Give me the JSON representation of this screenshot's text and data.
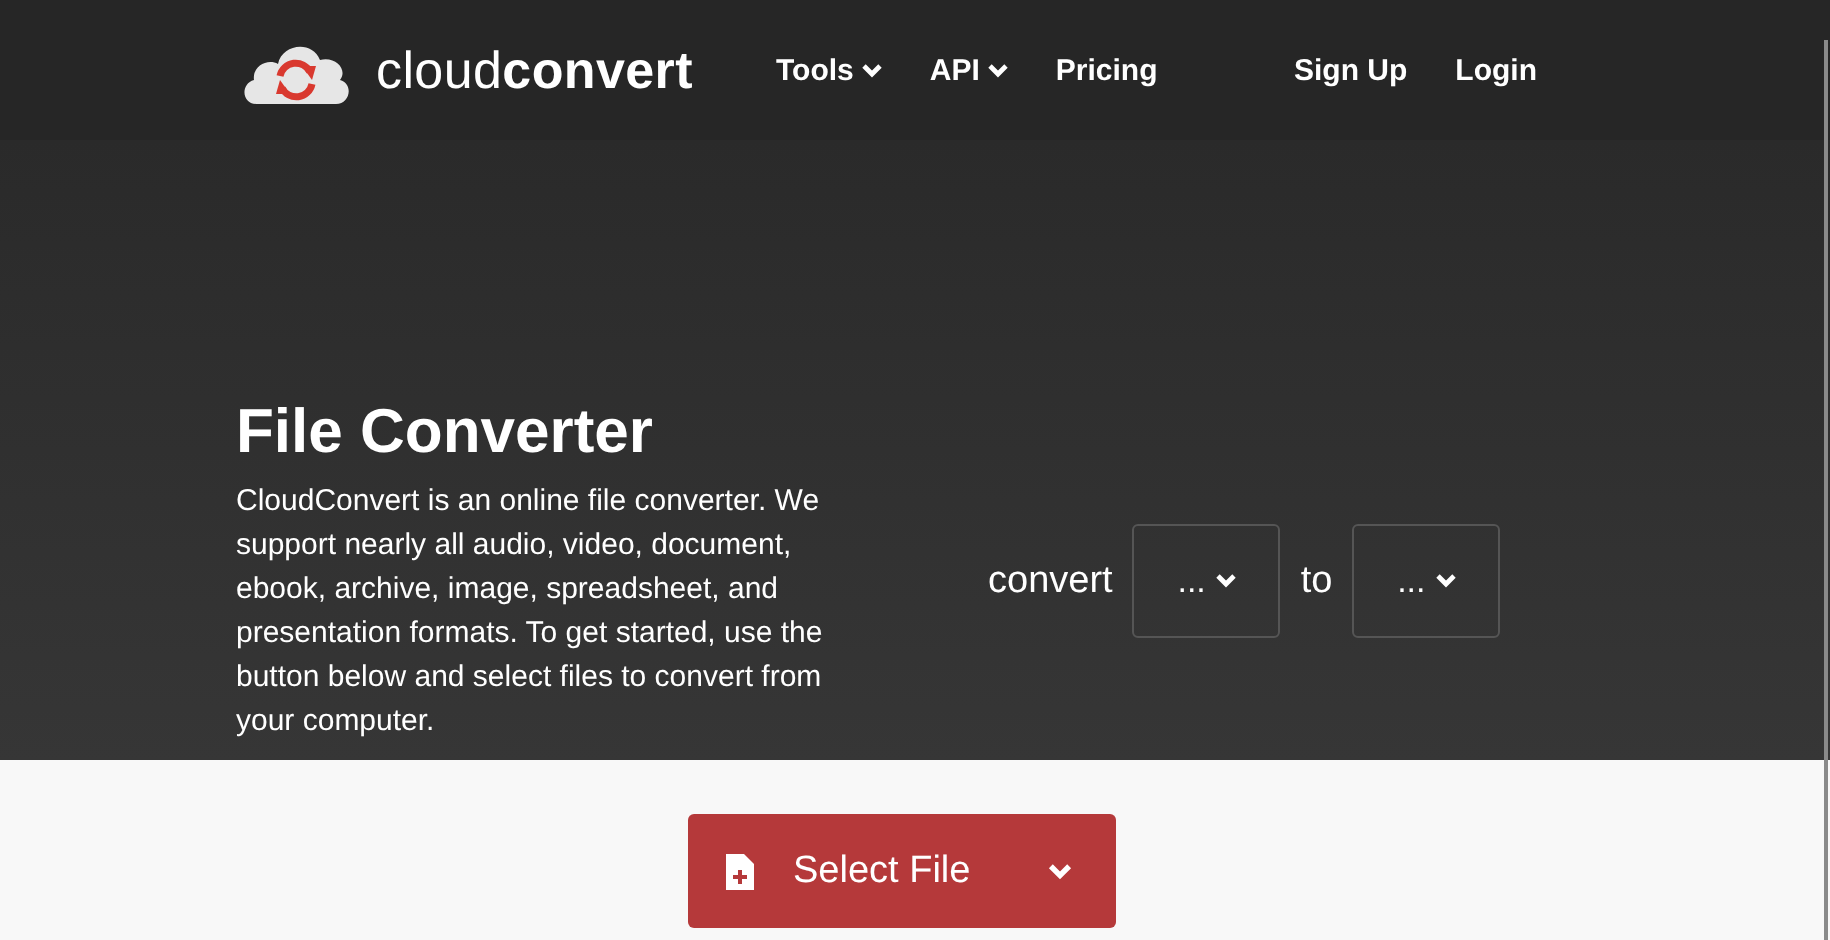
{
  "header": {
    "brand": "cloud**convert**",
    "nav": [
      {
        "label": "Tools",
        "dropdown": true
      },
      {
        "label": "API",
        "dropdown": true
      },
      {
        "label": "Pricing",
        "dropdown": false
      }
    ],
    "account": [
      "Sign Up",
      "Login"
    ]
  },
  "hero": {
    "title": "File Converter",
    "description": "CloudConvert is an online file converter. We support nearly all audio, video, document, ebook, archive, image, spreadsheet, and presentation formats. To get started, use the button below and select files to convert from your computer.",
    "converter": {
      "label": "convert",
      "from": "...",
      "joiner": "to",
      "to": "..."
    }
  },
  "select_button": {
    "label": "Select File"
  }
}
